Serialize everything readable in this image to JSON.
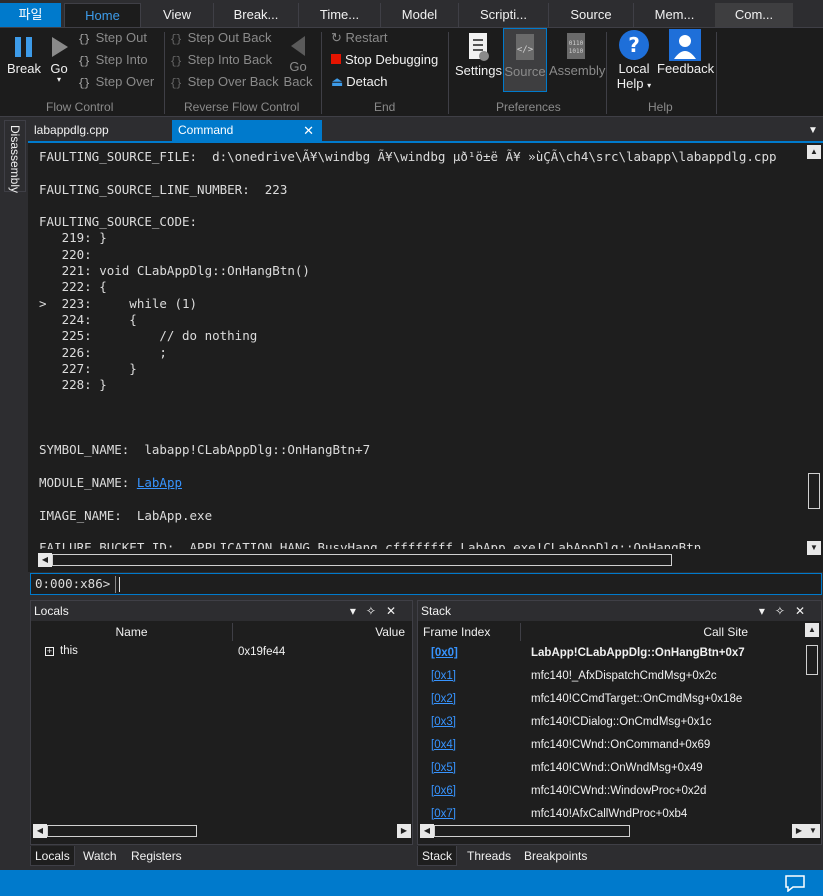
{
  "ribbon_tabs": [
    {
      "label": "파일",
      "kind": "file"
    },
    {
      "label": "Home",
      "kind": "active"
    },
    {
      "label": "View",
      "kind": "normal"
    },
    {
      "label": "Break...",
      "kind": "normal"
    },
    {
      "label": "Time...",
      "kind": "normal"
    },
    {
      "label": "Model",
      "kind": "normal"
    },
    {
      "label": "Scripti...",
      "kind": "normal"
    },
    {
      "label": "Source",
      "kind": "normal"
    },
    {
      "label": "Mem...",
      "kind": "normal"
    },
    {
      "label": "Com...",
      "kind": "highlight"
    }
  ],
  "ribbon": {
    "break_label": "Break",
    "go_label": "Go",
    "step_out": "Step Out",
    "step_into": "Step Into",
    "step_over": "Step Over",
    "flow_control": "Flow Control",
    "step_out_back": "Step Out Back",
    "step_into_back": "Step Into Back",
    "step_over_back": "Step Over Back",
    "go_back_1": "Go",
    "go_back_2": "Back",
    "reverse_flow_control": "Reverse Flow Control",
    "restart": "Restart",
    "stop_debugging": "Stop Debugging",
    "detach": "Detach",
    "end": "End",
    "settings": "Settings",
    "source": "Source",
    "assembly": "Assembly",
    "preferences": "Preferences",
    "local_help_1": "Local",
    "local_help_2": "Help",
    "feedback": "Feedback",
    "help": "Help"
  },
  "side_tab": "Disassembly",
  "doc_tabs": {
    "file": "labappdlg.cpp",
    "command": "Command"
  },
  "command_output": [
    {
      "t": "FAULTING_SOURCE_FILE:  d:\\onedrive\\Ã¥\\windbg Ã¥\\windbg µð¹ö±ë Ã¥ »ùÇÃ\\ch4\\src\\labapp\\labappdlg.cpp"
    },
    {
      "t": ""
    },
    {
      "t": "FAULTING_SOURCE_LINE_NUMBER:  223"
    },
    {
      "t": ""
    },
    {
      "t": "FAULTING_SOURCE_CODE:"
    },
    {
      "t": "   219: }"
    },
    {
      "t": "   220:"
    },
    {
      "t": "   221: void CLabAppDlg::OnHangBtn()"
    },
    {
      "t": "   222: {"
    },
    {
      "t": ">  223:     while (1)"
    },
    {
      "t": "   224:     {"
    },
    {
      "t": "   225:         // do nothing"
    },
    {
      "t": "   226:         ;"
    },
    {
      "t": "   227:     }"
    },
    {
      "t": "   228: }"
    },
    {
      "t": ""
    },
    {
      "t": ""
    },
    {
      "t": ""
    },
    {
      "t": "SYMBOL_NAME:  labapp!CLabAppDlg::OnHangBtn+7"
    },
    {
      "t": ""
    },
    {
      "t": "MODULE_NAME: ",
      "link": "LabApp"
    },
    {
      "t": ""
    },
    {
      "t": "IMAGE_NAME:  LabApp.exe"
    },
    {
      "t": ""
    },
    {
      "t": "FAILURE_BUCKET_ID:  APPLICATION_HANG_BusyHang_cffffffff_LabApp.exe!CLabAppDlg::OnHangBtn"
    }
  ],
  "prompt": "0:000:x86>",
  "locals": {
    "title": "Locals",
    "col_name": "Name",
    "col_value": "Value",
    "rows": [
      {
        "name": "this",
        "value": "0x19fe44"
      }
    ],
    "tabs": [
      "Locals",
      "Watch",
      "Registers"
    ]
  },
  "stack": {
    "title": "Stack",
    "col_frame": "Frame Index",
    "col_site": "Call Site",
    "rows": [
      {
        "idx": "[0x0]",
        "site": "LabApp!CLabAppDlg::OnHangBtn+0x7",
        "bold": true
      },
      {
        "idx": "[0x1]",
        "site": "mfc140!_AfxDispatchCmdMsg+0x2c"
      },
      {
        "idx": "[0x2]",
        "site": "mfc140!CCmdTarget::OnCmdMsg+0x18e"
      },
      {
        "idx": "[0x3]",
        "site": "mfc140!CDialog::OnCmdMsg+0x1c"
      },
      {
        "idx": "[0x4]",
        "site": "mfc140!CWnd::OnCommand+0x69"
      },
      {
        "idx": "[0x5]",
        "site": "mfc140!CWnd::OnWndMsg+0x49"
      },
      {
        "idx": "[0x6]",
        "site": "mfc140!CWnd::WindowProc+0x2d"
      },
      {
        "idx": "[0x7]",
        "site": "mfc140!AfxCallWndProc+0xb4"
      }
    ],
    "tabs": [
      "Stack",
      "Threads",
      "Breakpoints"
    ]
  }
}
